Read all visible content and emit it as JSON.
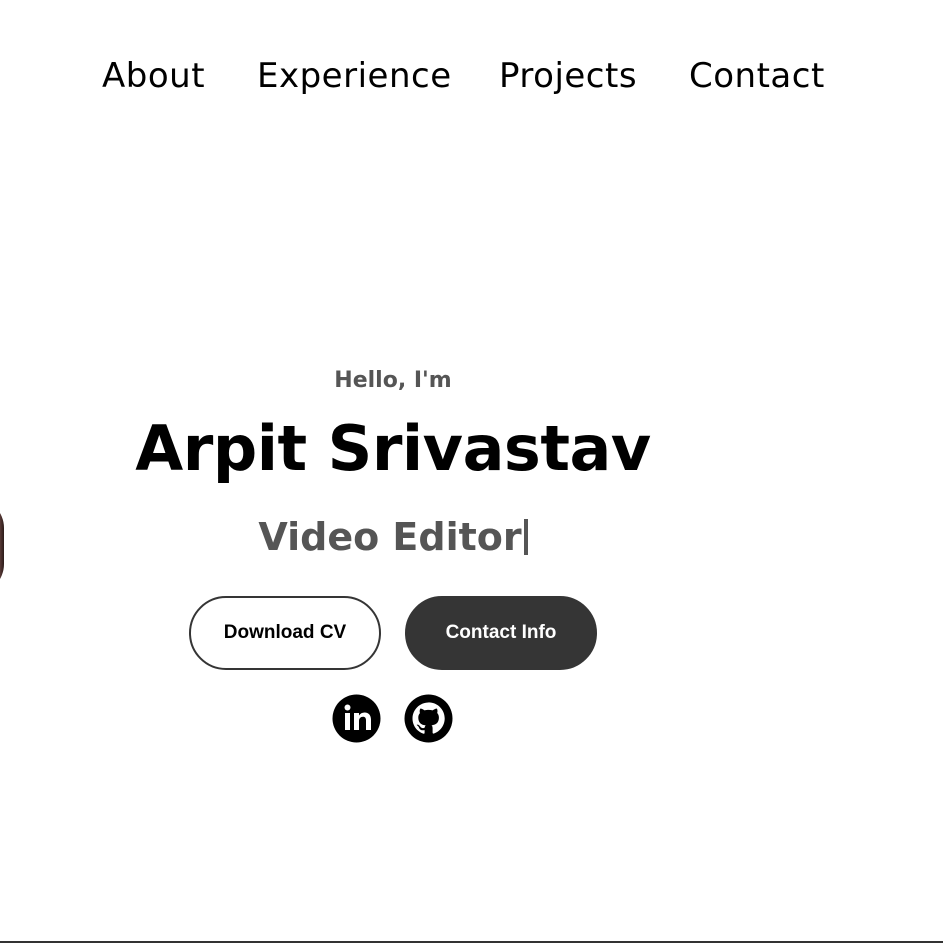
{
  "nav": {
    "items": [
      {
        "label": "About"
      },
      {
        "label": "Experience"
      },
      {
        "label": "Projects"
      },
      {
        "label": "Contact"
      }
    ]
  },
  "hero": {
    "greeting": "Hello, I'm",
    "name": "Arpit Srivastav",
    "role": "Video Editor",
    "buttons": {
      "download_cv": "Download CV",
      "contact_info": "Contact Info"
    },
    "social": [
      {
        "icon": "linkedin-icon"
      },
      {
        "icon": "github-icon"
      }
    ]
  },
  "colors": {
    "text": "#000000",
    "muted": "#555555",
    "button_dark": "#353535",
    "background": "#ffffff"
  }
}
